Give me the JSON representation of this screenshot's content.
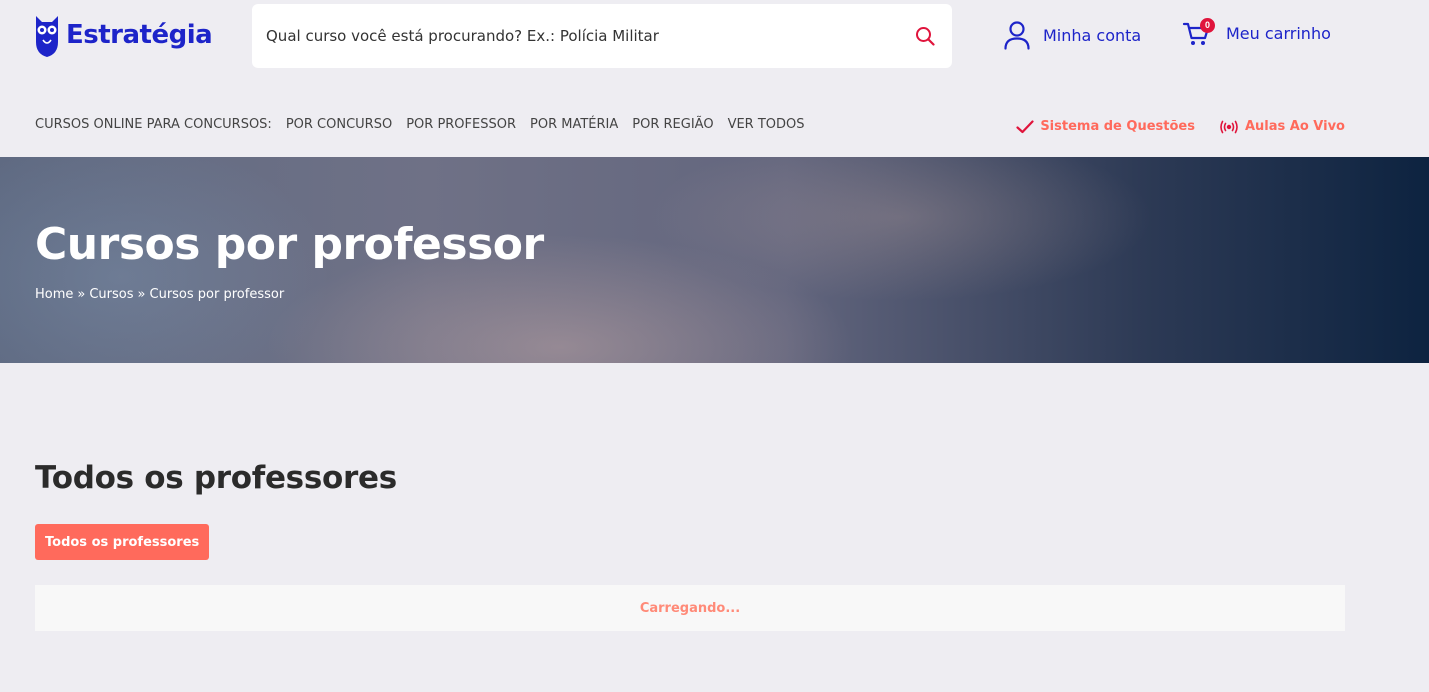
{
  "header": {
    "logo_text": "Estratégia",
    "search_placeholder": "Qual curso você está procurando? Ex.: Polícia Militar",
    "account_label": "Minha conta",
    "cart_label": "Meu carrinho",
    "cart_count": "0",
    "brand_color": "#1d24c9",
    "accent_color": "#ff6a5c"
  },
  "nav": {
    "prefix": "CURSOS ONLINE PARA CONCURSOS:",
    "items": [
      "POR CONCURSO",
      "POR PROFESSOR",
      "POR MATÉRIA",
      "POR REGIÃO",
      "VER TODOS"
    ]
  },
  "quick_links": {
    "questoes": "Sistema de Questões",
    "aulas": "Aulas Ao Vivo"
  },
  "hero": {
    "title": "Cursos por professor",
    "breadcrumb": [
      "Home",
      "»",
      "Cursos",
      "»",
      "Cursos por professor"
    ]
  },
  "main": {
    "section_title": "Todos os professores",
    "filter_label": "Todos os professores",
    "loading_text": "Carregando..."
  },
  "icons": {
    "search": "search-icon",
    "account": "user-icon",
    "cart": "cart-icon",
    "check": "check-icon",
    "live": "broadcast-icon"
  }
}
